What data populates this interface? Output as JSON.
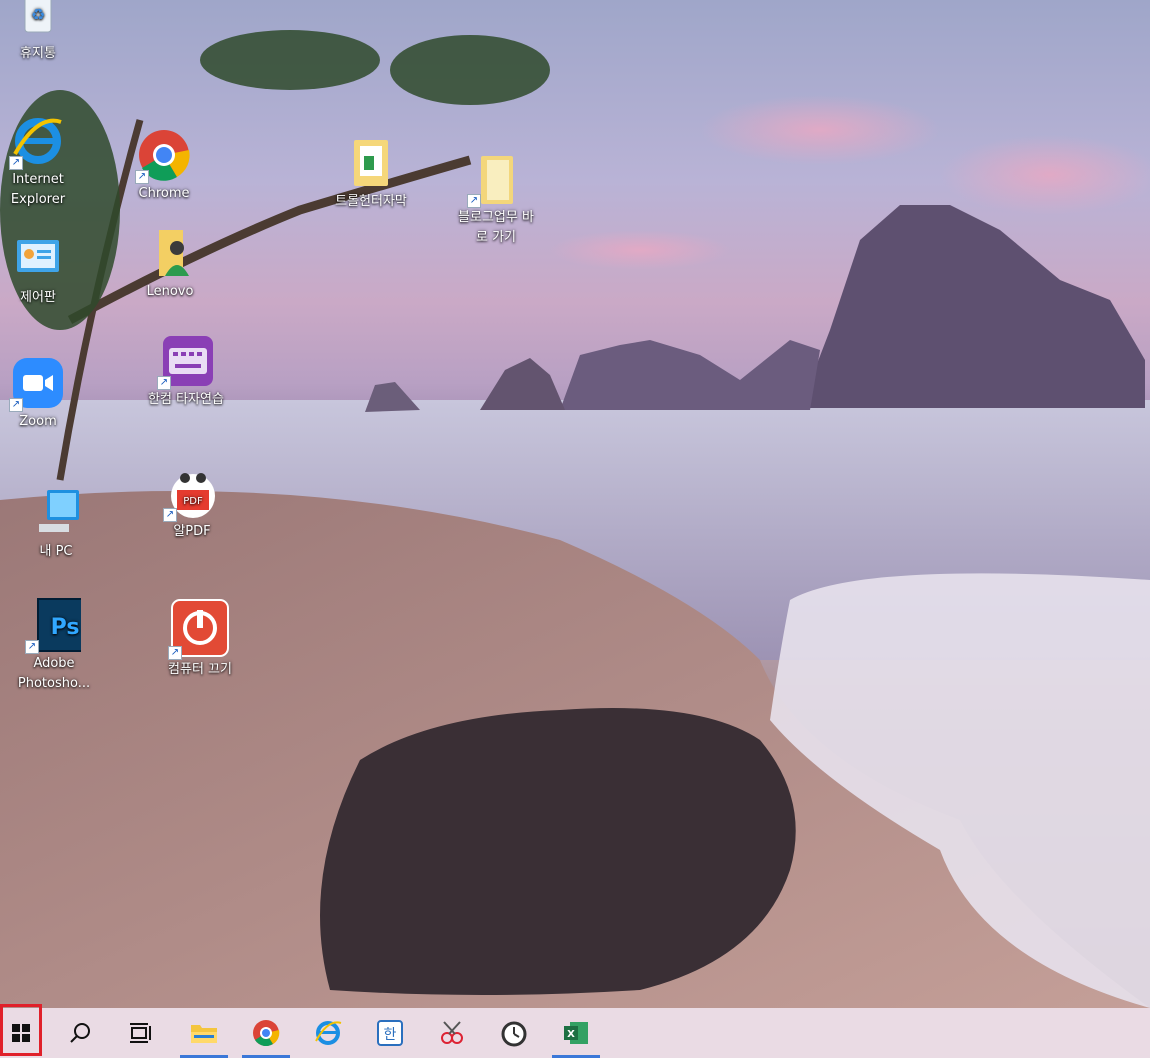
{
  "desktop": {
    "icons": [
      {
        "id": "recycle-bin",
        "label": "휴지통",
        "shortcut": false
      },
      {
        "id": "internet-explorer",
        "label": "Internet Explorer",
        "shortcut": true
      },
      {
        "id": "chrome",
        "label": "Chrome",
        "shortcut": true
      },
      {
        "id": "folder-trolley",
        "label": "트롤헌터자막",
        "shortcut": false
      },
      {
        "id": "folder-blog",
        "label": "블로그업무 바로 가기",
        "shortcut": true
      },
      {
        "id": "control-panel",
        "label": "제어판",
        "shortcut": false
      },
      {
        "id": "lenovo",
        "label": "Lenovo",
        "shortcut": false
      },
      {
        "id": "zoom",
        "label": "Zoom",
        "shortcut": true
      },
      {
        "id": "hancom-typing",
        "label": "한컴 타자연습",
        "shortcut": true
      },
      {
        "id": "this-pc",
        "label": "내 PC",
        "shortcut": false
      },
      {
        "id": "alpdf",
        "label": "알PDF",
        "shortcut": true
      },
      {
        "id": "photoshop",
        "label": "Adobe Photosho...",
        "shortcut": true
      },
      {
        "id": "shutdown",
        "label": "컴퓨터 끄기",
        "shortcut": true
      }
    ]
  },
  "taskbar": {
    "buttons": [
      {
        "id": "start",
        "icon": "windows-logo-icon"
      },
      {
        "id": "search",
        "icon": "search-icon"
      },
      {
        "id": "task-view",
        "icon": "task-view-icon"
      },
      {
        "id": "file-explorer",
        "icon": "folder-icon",
        "active": true
      },
      {
        "id": "chrome",
        "icon": "chrome-icon",
        "active": true
      },
      {
        "id": "internet-explorer",
        "icon": "ie-icon",
        "active": false
      },
      {
        "id": "hwp",
        "icon": "hwp-icon",
        "active": false
      },
      {
        "id": "snipping",
        "icon": "snipping-tool-icon",
        "active": false
      },
      {
        "id": "clock",
        "icon": "clock-icon",
        "active": false
      },
      {
        "id": "excel",
        "icon": "excel-icon",
        "active": true
      }
    ],
    "highlight_color": "#e0202a"
  }
}
